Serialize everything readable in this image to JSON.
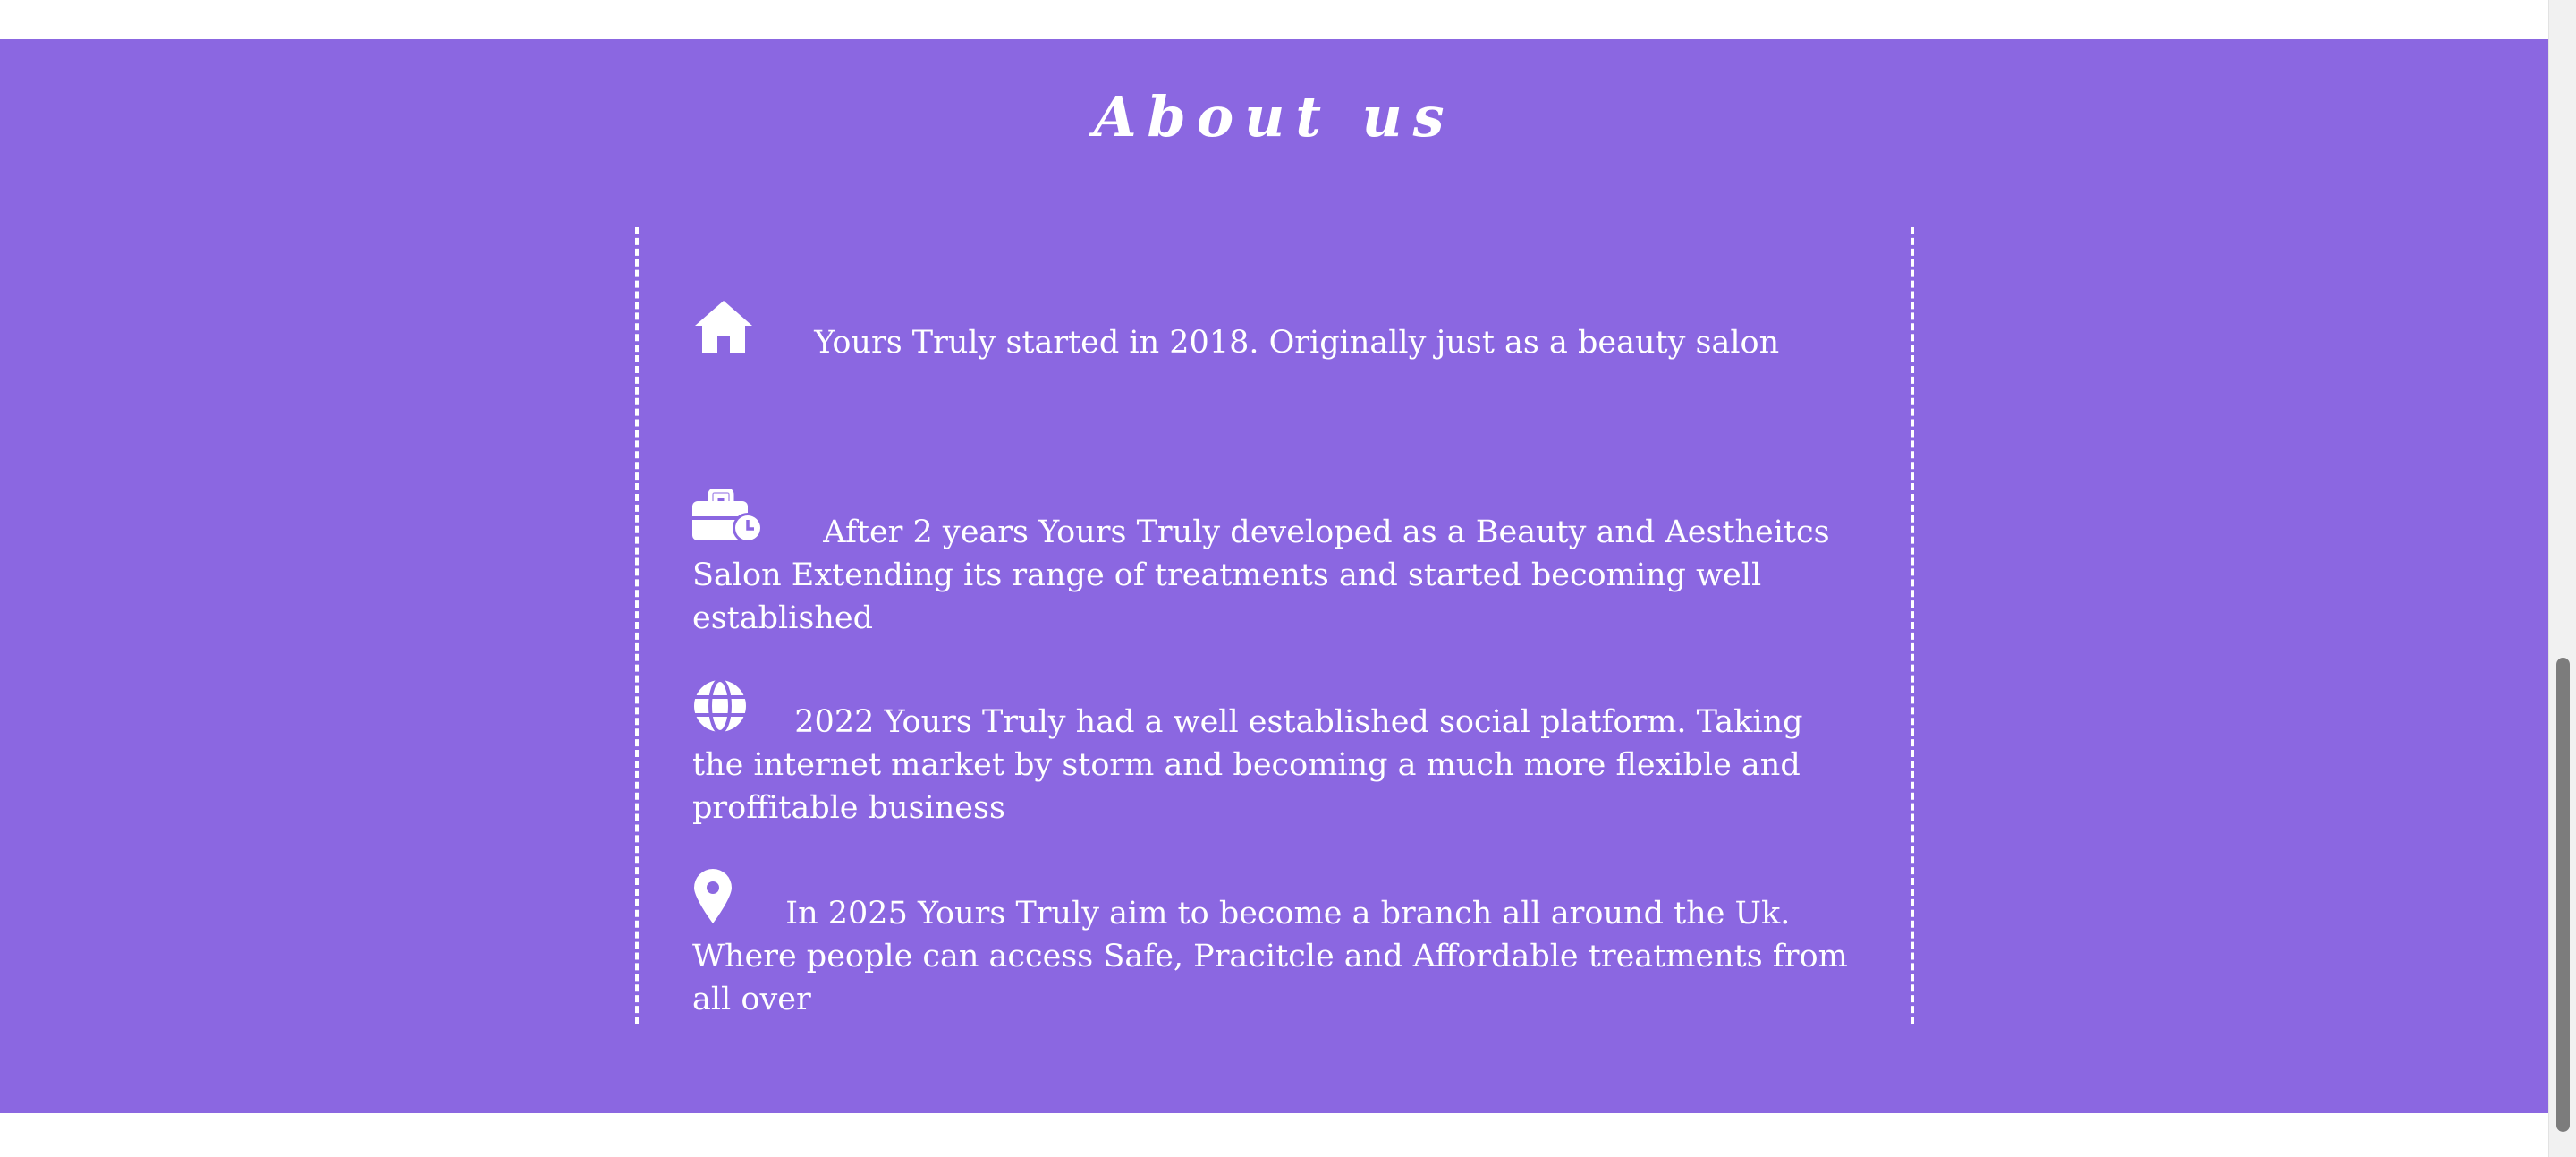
{
  "about": {
    "title": "About us",
    "background_color": "#8b67e1",
    "text_color": "#ffffff",
    "items": [
      {
        "icon": "home-icon",
        "text": "Yours Truly started in 2018. Originally just as a beauty salon"
      },
      {
        "icon": "briefcase-clock-icon",
        "text": "After 2 years Yours Truly developed as a Beauty and Aestheitcs Salon Extending its range of treatments and started becoming well established"
      },
      {
        "icon": "globe-icon",
        "text": "2022 Yours Truly had a well established social platform. Taking the internet market by storm and becoming a much more flexible and proffitable business"
      },
      {
        "icon": "location-pin-icon",
        "text": "In 2025 Yours Truly aim to become a branch all around the Uk. Where people can access Safe, Pracitcle and Affordable treatments from all over"
      }
    ]
  }
}
